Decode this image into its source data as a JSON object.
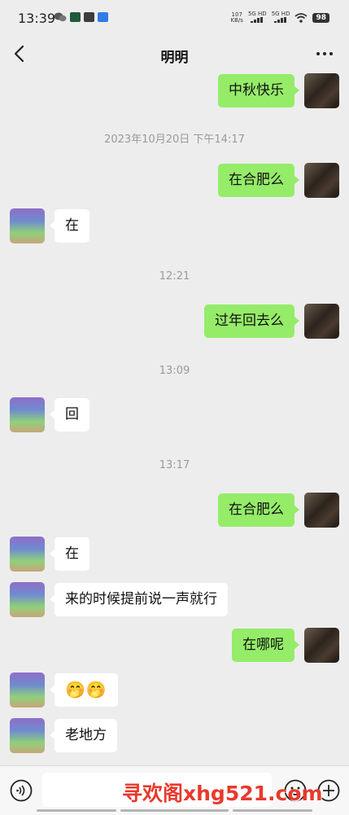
{
  "status_bar": {
    "time": "13:39",
    "net_speed_value": "107",
    "net_speed_unit": "KB/s",
    "signal_1": "5G HD",
    "signal_2": "5G HD",
    "battery": "98",
    "app_icons": [
      "wechat-icon",
      "app-icon-1",
      "app-icon-2",
      "app-icon-3"
    ]
  },
  "header": {
    "title": "明明",
    "back_icon": "chevron-left-icon",
    "more_icon": "more-dots-icon"
  },
  "messages": [
    {
      "type": "text",
      "side": "mine",
      "text": "中秋快乐"
    },
    {
      "type": "time",
      "text": "2023年10月20日 下午14:17"
    },
    {
      "type": "text",
      "side": "mine",
      "text": "在合肥么"
    },
    {
      "type": "text",
      "side": "other",
      "text": "在"
    },
    {
      "type": "time",
      "text": "12:21"
    },
    {
      "type": "text",
      "side": "mine",
      "text": "过年回去么"
    },
    {
      "type": "time",
      "text": "13:09"
    },
    {
      "type": "text",
      "side": "other",
      "text": "回"
    },
    {
      "type": "time",
      "text": "13:17"
    },
    {
      "type": "text",
      "side": "mine",
      "text": "在合肥么"
    },
    {
      "type": "text",
      "side": "other",
      "text": "在"
    },
    {
      "type": "text",
      "side": "other",
      "text": "来的时候提前说一声就行"
    },
    {
      "type": "text",
      "side": "mine",
      "text": "在哪呢"
    },
    {
      "type": "text",
      "side": "other",
      "text": "🤭🤭"
    },
    {
      "type": "text",
      "side": "other",
      "text": "老地方"
    }
  ],
  "input_bar": {
    "value": "",
    "voice_icon": "voice-icon",
    "emoji_icon": "emoji-icon",
    "plus_icon": "plus-icon"
  },
  "watermark": "寻欢阁xhg521.com",
  "colors": {
    "background": "#ededed",
    "my_bubble": "#95ec69",
    "their_bubble": "#ffffff",
    "watermark": "#e8392c"
  }
}
